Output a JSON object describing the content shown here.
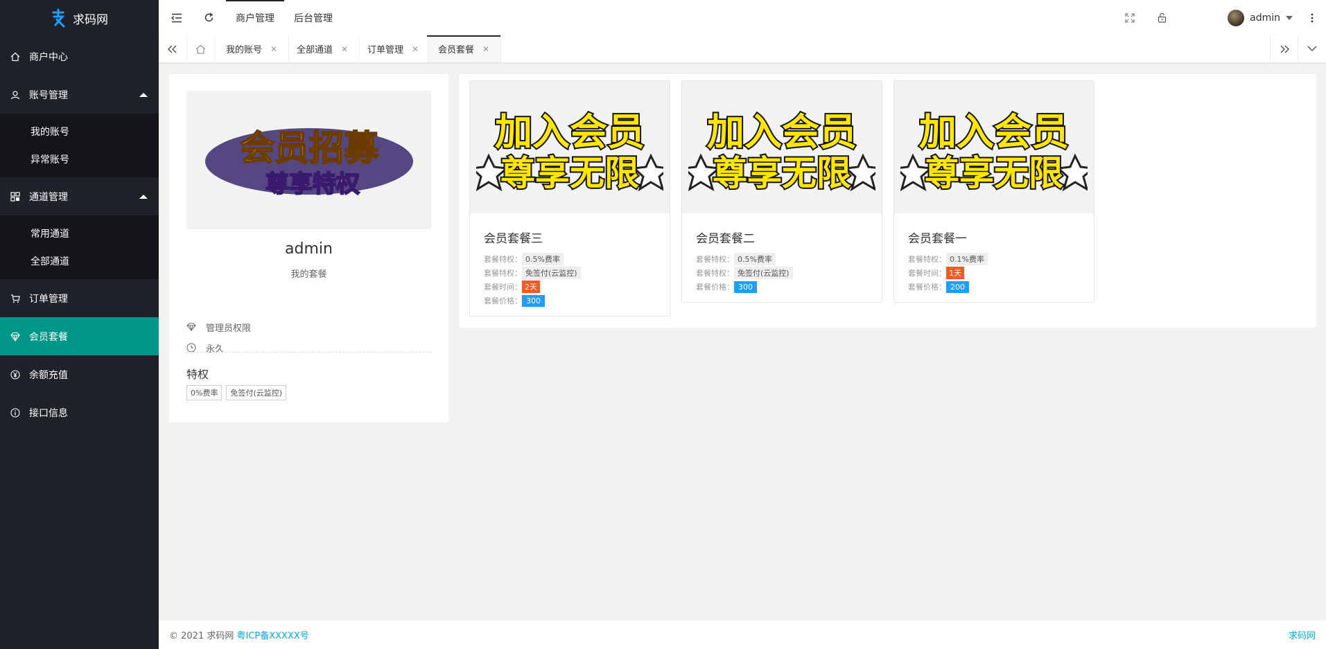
{
  "brand": {
    "name": "求码网"
  },
  "sidebar": {
    "items": [
      {
        "label": "商户中心"
      },
      {
        "label": "账号管理",
        "children": [
          {
            "label": "我的账号"
          },
          {
            "label": "异常账号"
          }
        ]
      },
      {
        "label": "通道管理",
        "children": [
          {
            "label": "常用通道"
          },
          {
            "label": "全部通道"
          }
        ]
      },
      {
        "label": "订单管理"
      },
      {
        "label": "会员套餐",
        "active": true
      },
      {
        "label": "余额充值"
      },
      {
        "label": "接口信息"
      }
    ]
  },
  "header": {
    "top_tabs": [
      {
        "label": "商户管理",
        "active": true
      },
      {
        "label": "后台管理"
      }
    ],
    "user": "admin"
  },
  "tabbar": {
    "tabs": [
      {
        "label": "我的账号"
      },
      {
        "label": "全部通道"
      },
      {
        "label": "订单管理"
      },
      {
        "label": "会员套餐",
        "active": true
      }
    ]
  },
  "profile": {
    "banner_line1": "会员招募",
    "banner_line2": "尊享特权",
    "name": "admin",
    "subtitle": "我的套餐",
    "role": "管理员权限",
    "duration": "永久",
    "privileges_title": "特权",
    "privileges": [
      "0%费率",
      "免签付(云监控)"
    ]
  },
  "packages": [
    {
      "title": "会员套餐三",
      "banner_line1": "加入会员",
      "banner_line2": "尊享无限",
      "rows": [
        {
          "label": "套餐特权：",
          "value": "0.5%费率",
          "style": "gray"
        },
        {
          "label": "套餐特权：",
          "value": "免签付(云监控)",
          "style": "gray"
        },
        {
          "label": "套餐时间：",
          "value": "2天",
          "style": "orange"
        },
        {
          "label": "套餐价格：",
          "value": "300",
          "style": "blue"
        }
      ]
    },
    {
      "title": "会员套餐二",
      "banner_line1": "加入会员",
      "banner_line2": "尊享无限",
      "rows": [
        {
          "label": "套餐特权：",
          "value": "0.5%费率",
          "style": "gray"
        },
        {
          "label": "套餐特权：",
          "value": "免签付(云监控)",
          "style": "gray"
        },
        {
          "label": "套餐价格：",
          "value": "300",
          "style": "blue"
        }
      ]
    },
    {
      "title": "会员套餐一",
      "banner_line1": "加入会员",
      "banner_line2": "尊享无限",
      "rows": [
        {
          "label": "套餐特权：",
          "value": "0.1%费率",
          "style": "gray"
        },
        {
          "label": "套餐时间：",
          "value": "1天",
          "style": "orange"
        },
        {
          "label": "套餐价格：",
          "value": "200",
          "style": "blue"
        }
      ]
    }
  ],
  "footer": {
    "copyright": "© 2021 求码网",
    "icp": "粤ICP备XXXXX号",
    "right_link": "求码网"
  },
  "colors": {
    "sidebar_bg": "#20222a",
    "active_green": "#009688",
    "orange": "#ff5722",
    "blue": "#1e9fff",
    "link": "#01aaed"
  }
}
